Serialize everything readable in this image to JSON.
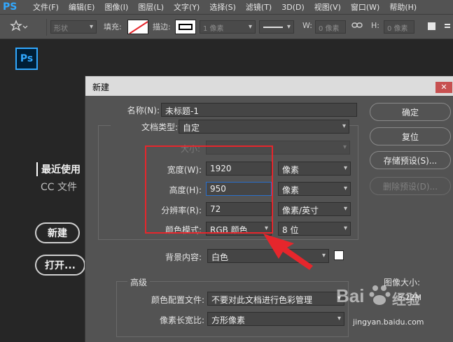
{
  "menubar": {
    "app_glyph": "PS",
    "items": [
      "文件(F)",
      "编辑(E)",
      "图像(I)",
      "图层(L)",
      "文字(Y)",
      "选择(S)",
      "滤镜(T)",
      "3D(D)",
      "视图(V)",
      "窗口(W)",
      "帮助(H)"
    ]
  },
  "options_bar": {
    "tool_icon": "shape-tool-icon",
    "shape_mode": "形状",
    "fill_label": "填充:",
    "stroke_label": "描边:",
    "stroke_width": "1 像素",
    "w_label": "W:",
    "w_value": "0 像素",
    "h_label": "H:",
    "h_value": "0 像素"
  },
  "start": {
    "logo": "Ps",
    "recent": "最近使用",
    "cc_files": "CC 文件",
    "new_button": "新建",
    "open_button": "打开..."
  },
  "dialog": {
    "title": "新建",
    "name_label": "名称(N):",
    "name_value": "未标题-1",
    "doc_type_label": "文档类型:",
    "doc_type_value": "自定",
    "size_label": "大小:",
    "width_label": "宽度(W):",
    "width_value": "1920",
    "width_unit": "像素",
    "height_label": "高度(H):",
    "height_value": "950",
    "height_unit": "像素",
    "resolution_label": "分辨率(R):",
    "resolution_value": "72",
    "resolution_unit": "像素/英寸",
    "color_mode_label": "颜色模式:",
    "color_mode_value": "RGB 颜色",
    "bit_depth": "8 位",
    "background_label": "背景内容:",
    "background_value": "白色",
    "advanced_title": "高级",
    "color_profile_label": "颜色配置文件:",
    "color_profile_value": "不要对此文档进行色彩管理",
    "pixel_aspect_label": "像素长宽比:",
    "pixel_aspect_value": "方形像素",
    "image_size_label": "图像大小:",
    "image_size_value": "5.22M",
    "buttons": {
      "ok": "确定",
      "reset": "复位",
      "save_preset": "存储预设(S)...",
      "delete_preset": "删除预设(D)..."
    }
  },
  "watermark": {
    "brand": "Bai",
    "brand2": "经验",
    "url": "jingyan.baidu.com"
  },
  "colors": {
    "highlight_red": "#e6262c",
    "ps_blue": "#31a8ff"
  }
}
